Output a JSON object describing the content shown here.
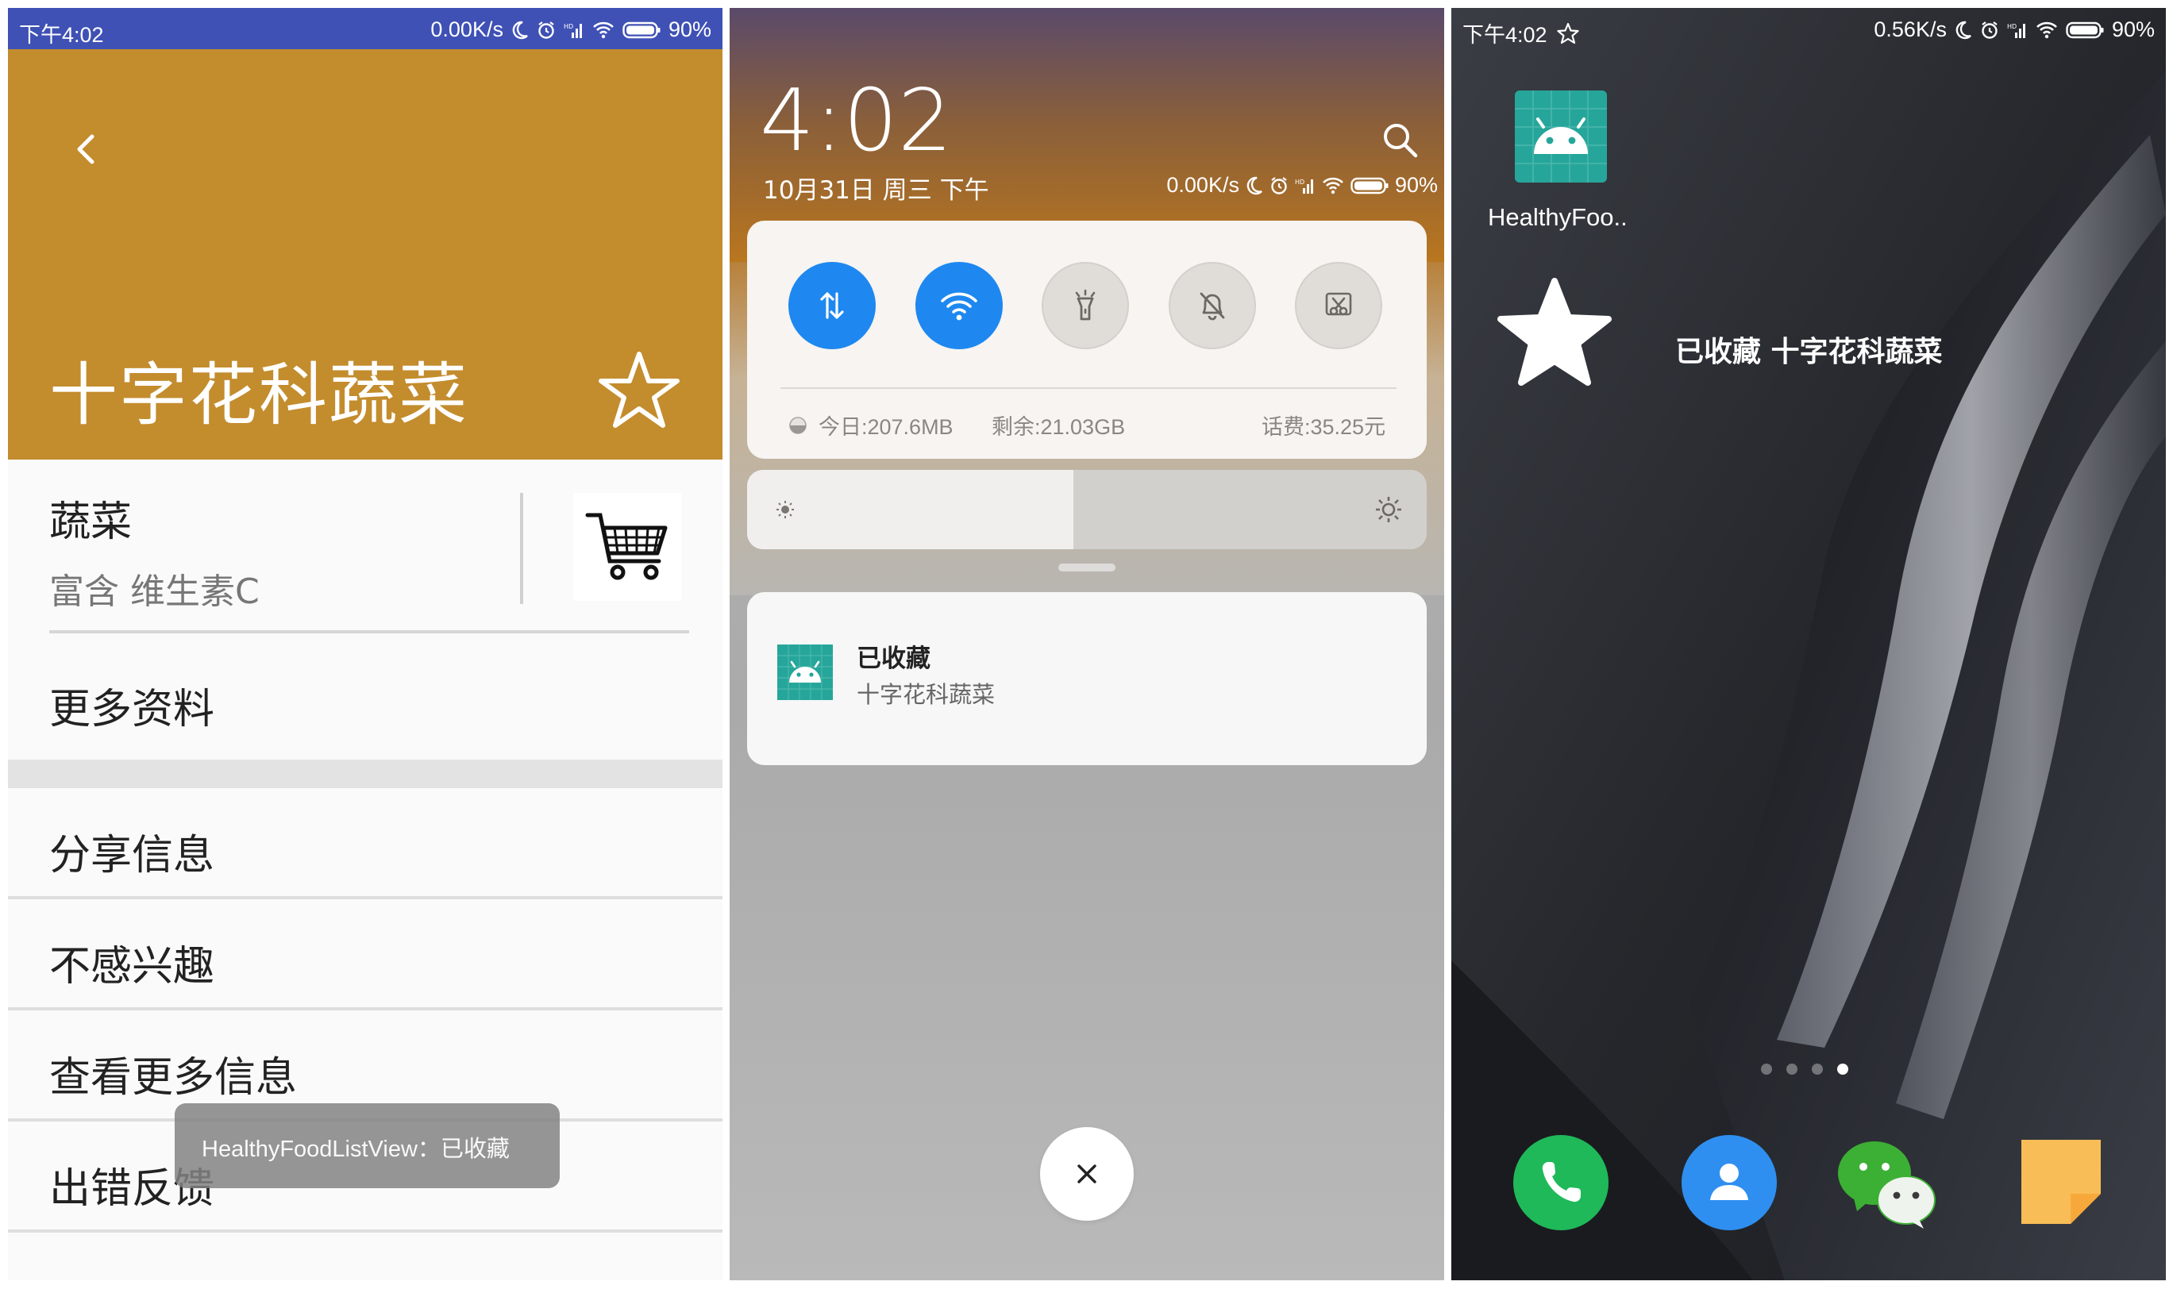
{
  "status_bar": {
    "time": "下午4:02",
    "net_speed_left": "0.00K/s",
    "net_speed_right": "0.56K/s",
    "battery": "90%"
  },
  "detail": {
    "title": "十字花科蔬菜",
    "category": "蔬菜",
    "description": "富含 维生素C",
    "more_info": "更多资料",
    "menu": [
      "分享信息",
      "不感兴趣",
      "查看更多信息",
      "出错反馈"
    ],
    "toast": "HealthyFoodListView：已收藏"
  },
  "shade": {
    "clock": "4:02",
    "date": "10月31日 周三 下午",
    "net_speed": "0.00K/s",
    "battery": "90%",
    "data_today": "今日:207.6MB",
    "data_left": "剩余:21.03GB",
    "balance": "话费:35.25元",
    "brightness_level": 0.48,
    "notification": {
      "title": "已收藏",
      "text": "十字花科蔬菜"
    }
  },
  "home": {
    "app_label": "HealthyFoo..",
    "fav_text": "已收藏 十字花科蔬菜",
    "pages": 4,
    "active_page": 4
  }
}
